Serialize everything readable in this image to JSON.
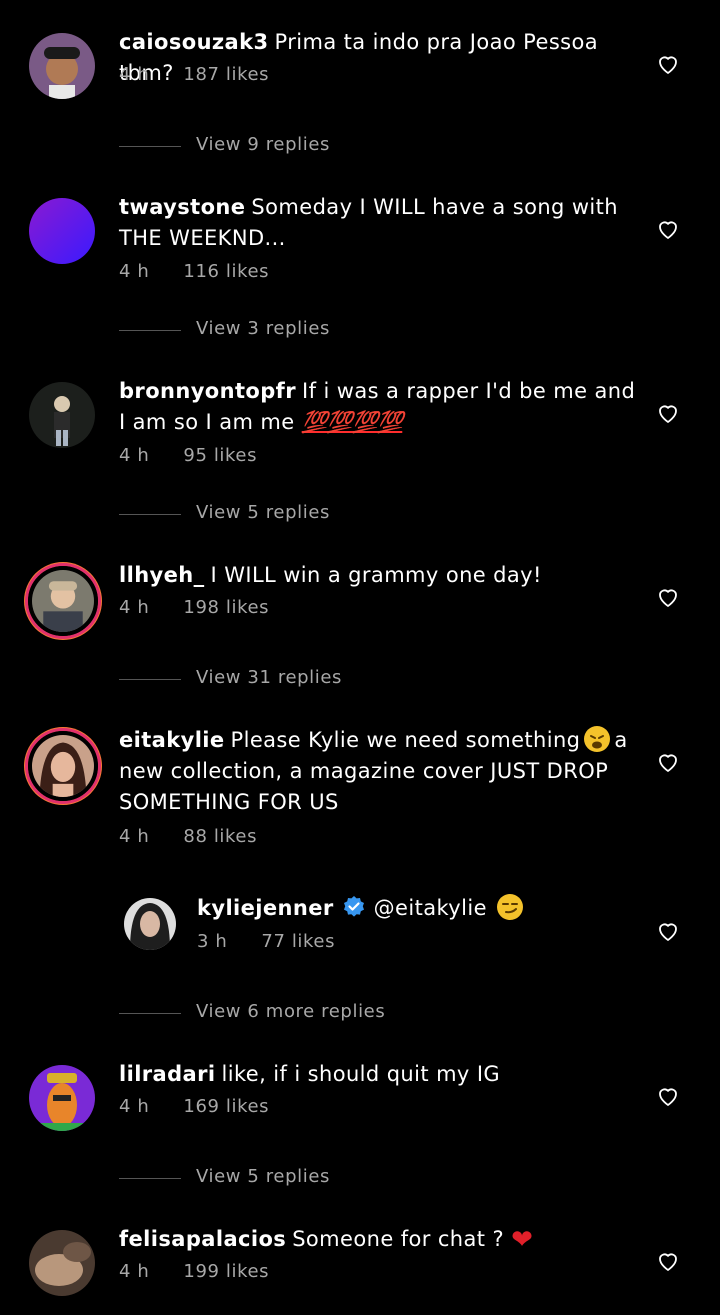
{
  "comments": [
    {
      "username": "caiosouzak3",
      "text": "Prima ta indo pra Joao Pessoa tbm?",
      "time": "4 h",
      "likes": "187 likes",
      "replies": "View 9 replies"
    },
    {
      "username": "twaystone",
      "text": "Someday I WILL have a song with THE WEEKND...",
      "time": "4 h",
      "likes": "116 likes",
      "replies": "View 3 replies"
    },
    {
      "username": "bronnyontopfr",
      "text": "If i was a rapper I'd be me and I am so I am me",
      "emoji": "💯💯💯💯",
      "time": "4 h",
      "likes": "95 likes",
      "replies": "View 5 replies"
    },
    {
      "username": "llhyeh_",
      "text": "I WILL win a grammy one day!",
      "time": "4 h",
      "likes": "198 likes",
      "replies": "View 31 replies"
    },
    {
      "username": "eitakylie",
      "text_a": "Please Kylie we need something",
      "text_b": "a new collection, a magazine cover JUST DROP SOMETHING FOR US",
      "time": "4 h",
      "likes": "88 likes",
      "replies": "View 6 more replies"
    },
    {
      "username": "lilradari",
      "text": "like, if i should quit my IG",
      "time": "4 h",
      "likes": "169 likes",
      "replies": "View 5 replies"
    },
    {
      "username": "felisapalacios",
      "text": "Someone for chat ?",
      "time": "4 h",
      "likes": "199 likes"
    }
  ],
  "reply": {
    "username": "kyliejenner",
    "mention": "@eitakylie",
    "time": "3 h",
    "likes": "77 likes"
  },
  "icons": {
    "like": "heart-outline-icon",
    "verified": "verified-badge-icon"
  },
  "colors": {
    "background": "#000000",
    "meta": "#a8a8a8",
    "verified": "#3897f0"
  }
}
